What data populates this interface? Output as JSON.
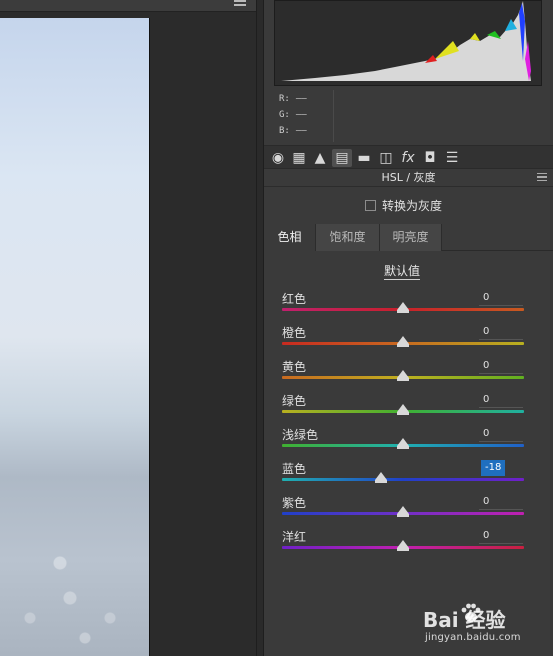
{
  "histogram": {
    "rgb": [
      {
        "channel": "R:",
        "value": "——"
      },
      {
        "channel": "G:",
        "value": "——"
      },
      {
        "channel": "B:",
        "value": "——"
      }
    ]
  },
  "toolbar": {
    "tools": [
      {
        "name": "basic-icon",
        "glyph": "◉"
      },
      {
        "name": "tone-curve-icon",
        "glyph": "▦"
      },
      {
        "name": "detail-icon",
        "glyph": "▲"
      },
      {
        "name": "hsl-icon",
        "glyph": "▤"
      },
      {
        "name": "split-toning-icon",
        "glyph": "▬"
      },
      {
        "name": "lens-corrections-icon",
        "glyph": "◫"
      },
      {
        "name": "effects-icon",
        "glyph": "fx"
      },
      {
        "name": "camera-calibration-icon",
        "glyph": "◘"
      },
      {
        "name": "presets-icon",
        "glyph": "☰"
      }
    ]
  },
  "panel": {
    "title": "HSL / 灰度",
    "convert_grayscale_label": "转换为灰度",
    "convert_grayscale_checked": false
  },
  "tabs": [
    {
      "label": "色相",
      "active": true
    },
    {
      "label": "饱和度",
      "active": false
    },
    {
      "label": "明亮度",
      "active": false
    }
  ],
  "default_label": "默认值",
  "sliders": [
    {
      "label": "红色",
      "value": "0",
      "level": 0,
      "gradient": [
        "#c0206e",
        "#c8202a",
        "#c85a20"
      ]
    },
    {
      "label": "橙色",
      "value": "0",
      "level": 0,
      "gradient": [
        "#c82a20",
        "#c86a20",
        "#b8b020"
      ]
    },
    {
      "label": "黄色",
      "value": "0",
      "level": 0,
      "gradient": [
        "#c86a20",
        "#c0b020",
        "#60b020"
      ]
    },
    {
      "label": "绿色",
      "value": "0",
      "level": 0,
      "gradient": [
        "#b8b020",
        "#40b030",
        "#20b0a0"
      ]
    },
    {
      "label": "浅绿色",
      "value": "0",
      "level": 0,
      "gradient": [
        "#40b030",
        "#20b0b0",
        "#2060c8"
      ]
    },
    {
      "label": "蓝色",
      "value": "-18",
      "level": -18,
      "gradient": [
        "#20b0b0",
        "#2040c8",
        "#7020c8"
      ]
    },
    {
      "label": "紫色",
      "value": "0",
      "level": 0,
      "gradient": [
        "#2040c8",
        "#7030c8",
        "#c020b0"
      ]
    },
    {
      "label": "洋红",
      "value": "0",
      "level": 0,
      "gradient": [
        "#7020c8",
        "#c020b0",
        "#c82040"
      ]
    }
  ],
  "watermark": {
    "brand": "Bai  经验",
    "url": "jingyan.baidu.com"
  }
}
